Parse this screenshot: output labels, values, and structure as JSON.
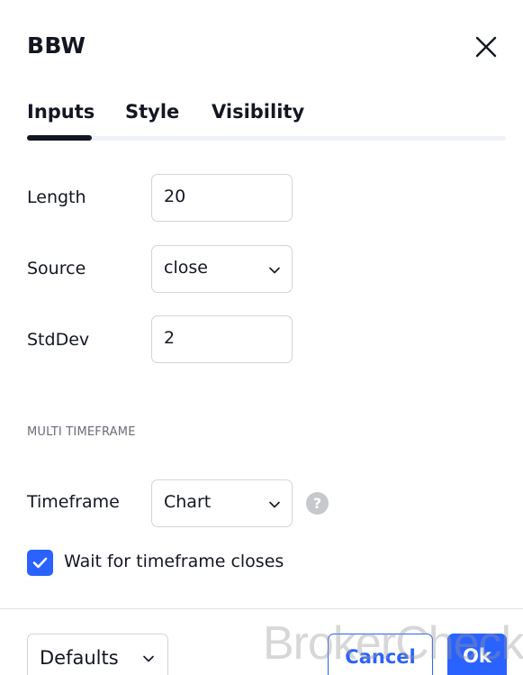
{
  "dialog": {
    "title": "BBW"
  },
  "tabs": [
    {
      "label": "Inputs",
      "active": true
    },
    {
      "label": "Style",
      "active": false
    },
    {
      "label": "Visibility",
      "active": false
    }
  ],
  "inputs": {
    "length": {
      "label": "Length",
      "value": "20"
    },
    "source": {
      "label": "Source",
      "value": "close"
    },
    "stddev": {
      "label": "StdDev",
      "value": "2"
    }
  },
  "multi_timeframe": {
    "header": "MULTI TIMEFRAME",
    "timeframe": {
      "label": "Timeframe",
      "value": "Chart"
    },
    "help_glyph": "?",
    "wait_checkbox": {
      "label": "Wait for timeframe closes",
      "checked": true
    }
  },
  "footer": {
    "defaults_label": "Defaults",
    "cancel_label": "Cancel",
    "ok_label": "Ok"
  },
  "watermark": "BrokerCheck",
  "icons": {
    "close": "close-icon",
    "chevron": "chevron-down-icon",
    "help": "question-mark-icon",
    "check": "checkmark-icon"
  },
  "colors": {
    "accent": "#2962ff",
    "text": "#131722",
    "muted": "#6a6d78",
    "border": "#d1d4dc",
    "help_bg": "#c6c8cd"
  }
}
